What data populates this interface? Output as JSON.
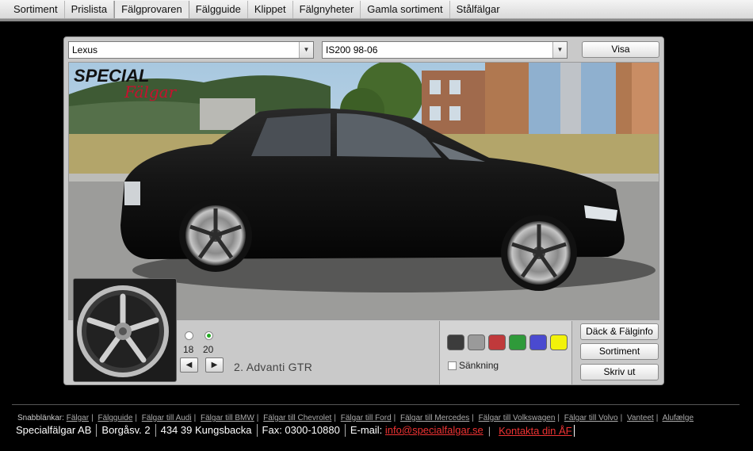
{
  "nav": {
    "items": [
      {
        "label": "Sortiment"
      },
      {
        "label": "Prislista"
      },
      {
        "label": "Fälgprovaren"
      },
      {
        "label": "Fälgguide"
      },
      {
        "label": "Klippet"
      },
      {
        "label": "Fälgnyheter"
      },
      {
        "label": "Gamla sortiment"
      },
      {
        "label": "Stålfälgar"
      }
    ],
    "active_index": 2
  },
  "selector": {
    "make": "Lexus",
    "model": "IS200 98-06",
    "show_button": "Visa"
  },
  "image": {
    "logo_text": "SPECIAL",
    "logo_script": "Fälgar"
  },
  "wheel": {
    "sizes": [
      {
        "label": "18",
        "checked": false
      },
      {
        "label": "20",
        "checked": true
      }
    ],
    "name": "2. Advanti GTR",
    "prev_icon": "◀",
    "next_icon": "▶"
  },
  "colors": {
    "swatches": [
      "#3c3c3c",
      "#9a9a9a",
      "#c0393b",
      "#2f9a3a",
      "#4a4ad0",
      "#f2f20a"
    ],
    "lowering_label": "Sänkning",
    "lowering_checked": false
  },
  "actions": {
    "tire_info": "Däck & Fälginfo",
    "range": "Sortiment",
    "print": "Skriv ut"
  },
  "footer": {
    "quicklinks_label": "Snabblänkar:",
    "quicklinks": [
      "Fälgar",
      "Fälgguide",
      "Fälgar till Audi",
      "Fälgar till BMW",
      "Fälgar till Chevrolet",
      "Fälgar till Ford",
      "Fälgar till Mercedes",
      "Fälgar till Volkswagen",
      "Fälgar till Volvo",
      "Vanteet",
      "Alufælge"
    ],
    "company": "Specialfälgar AB",
    "address": "Borgåsv. 2",
    "postal": "434 39 Kungsbacka",
    "fax": "Fax: 0300-10880",
    "email_label": "E-mail:",
    "email": "info@specialfalgar.se",
    "dealer_link": "Kontakta din ÅF"
  }
}
